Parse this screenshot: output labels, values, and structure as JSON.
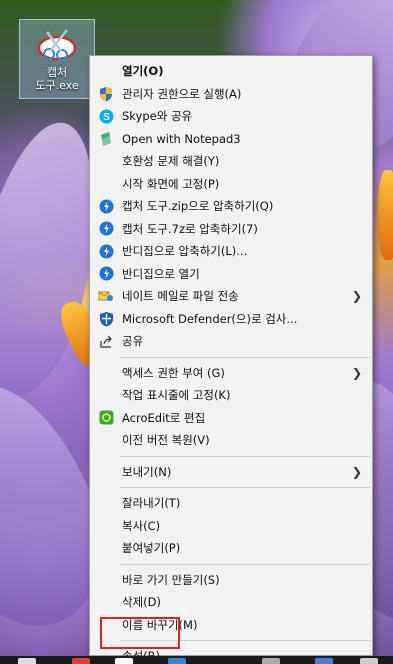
{
  "desktop": {
    "icon_label": "캡처\n도구.exe"
  },
  "menu": {
    "items": [
      {
        "label": "열기(O)",
        "icon": "none",
        "bold": true
      },
      {
        "label": "관리자 권한으로 실행(A)",
        "icon": "uac-shield-icon"
      },
      {
        "label": "Skype와 공유",
        "icon": "skype-icon"
      },
      {
        "label": "Open with Notepad3",
        "icon": "notepad3-icon"
      },
      {
        "label": "호환성 문제 해결(Y)",
        "icon": "none"
      },
      {
        "label": "시작 화면에 고정(P)",
        "icon": "none"
      },
      {
        "label": "캡처 도구.zip으로 압축하기(Q)",
        "icon": "bandizip-icon"
      },
      {
        "label": "캡처 도구.7z로 압축하기(7)",
        "icon": "bandizip-icon"
      },
      {
        "label": "반디집으로 압축하기(L)...",
        "icon": "bandizip-icon"
      },
      {
        "label": "반디집으로 열기",
        "icon": "bandizip-icon"
      },
      {
        "label": "네이트 메일로 파일 전송",
        "icon": "nate-icon",
        "submenu": true
      },
      {
        "label": "Microsoft Defender(으)로 검사...",
        "icon": "defender-icon"
      },
      {
        "label": "공유",
        "icon": "share-icon"
      },
      {
        "label": "액세스 권한 부여 (G)",
        "icon": "none",
        "submenu": true,
        "sep_before": true
      },
      {
        "label": "작업 표시줄에 고정(K)",
        "icon": "none"
      },
      {
        "label": "AcroEdit로 편집",
        "icon": "acroedit-icon"
      },
      {
        "label": "이전 버전 복원(V)",
        "icon": "none"
      },
      {
        "label": "보내기(N)",
        "icon": "none",
        "submenu": true,
        "sep_before": true
      },
      {
        "label": "잘라내기(T)",
        "icon": "none",
        "sep_before": true
      },
      {
        "label": "복사(C)",
        "icon": "none"
      },
      {
        "label": "붙여넣기(P)",
        "icon": "none"
      },
      {
        "label": "바로 가기 만들기(S)",
        "icon": "none",
        "sep_before": true
      },
      {
        "label": "삭제(D)",
        "icon": "none"
      },
      {
        "label": "이름 바꾸기(M)",
        "icon": "none"
      },
      {
        "label": "속성(R)",
        "icon": "none",
        "sep_before": true
      }
    ]
  },
  "colors": {
    "menu_bg": "#f2f2f2",
    "highlight_border": "#e02020",
    "bandizip_blue": "#1f73d8"
  }
}
